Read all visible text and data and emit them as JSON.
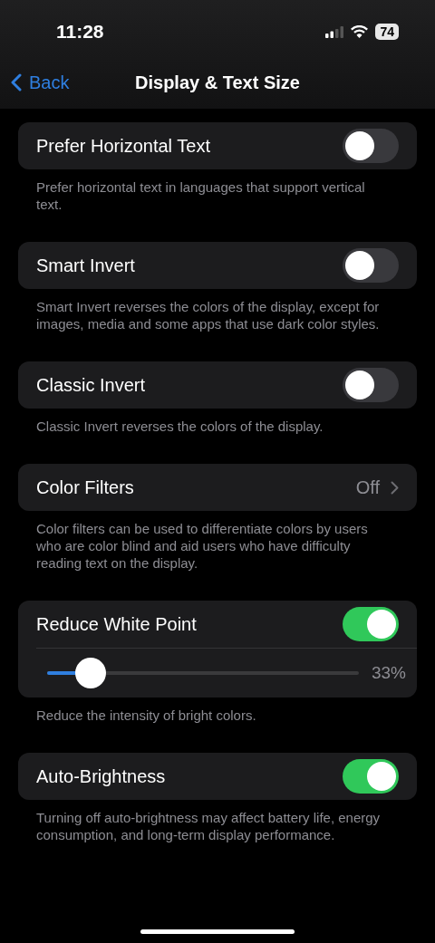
{
  "status_bar": {
    "time": "11:28",
    "battery": "74"
  },
  "nav": {
    "back": "Back",
    "title": "Display & Text Size"
  },
  "groups": [
    {
      "rows": [
        {
          "kind": "toggle",
          "label": "Prefer Horizontal Text",
          "on": false
        }
      ],
      "footer": "Prefer horizontal text in languages that support vertical text."
    },
    {
      "rows": [
        {
          "kind": "toggle",
          "label": "Smart Invert",
          "on": false
        }
      ],
      "footer": "Smart Invert reverses the colors of the display, except for images, media and some apps that use dark color styles."
    },
    {
      "rows": [
        {
          "kind": "toggle",
          "label": "Classic Invert",
          "on": false
        }
      ],
      "footer": "Classic Invert reverses the colors of the display."
    },
    {
      "rows": [
        {
          "kind": "disclosure",
          "label": "Color Filters",
          "value": "Off"
        }
      ],
      "footer": "Color filters can be used to differentiate colors by users who are color blind and aid users who have difficulty reading text on the display."
    },
    {
      "rows": [
        {
          "kind": "toggle",
          "label": "Reduce White Point",
          "on": true
        },
        {
          "kind": "slider",
          "level": 0.14,
          "reading": "33%"
        }
      ],
      "footer": "Reduce the intensity of bright colors."
    },
    {
      "rows": [
        {
          "kind": "toggle",
          "label": "Auto-Brightness",
          "on": true
        }
      ],
      "footer": "Turning off auto-brightness may affect battery life, energy consumption, and long-term display performance."
    }
  ]
}
